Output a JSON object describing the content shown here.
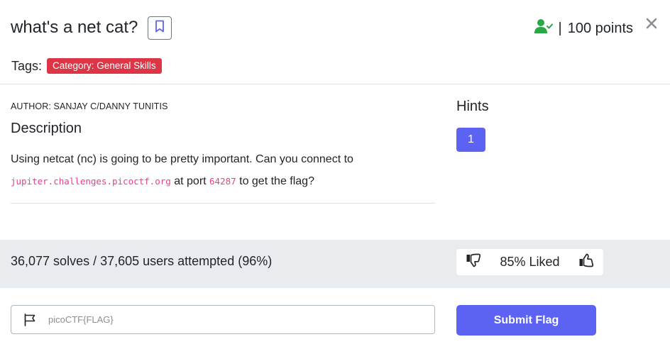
{
  "challenge": {
    "title": "what's a net cat?",
    "points_sep": "|",
    "points": "100 points"
  },
  "tags": {
    "label": "Tags:",
    "items": [
      "Category: General Skills"
    ]
  },
  "author": "AUTHOR: SANJAY C/DANNY TUNITIS",
  "description": {
    "heading": "Description",
    "text_1": "Using netcat (nc) is going to be pretty important. Can you connect to",
    "host": "jupiter.challenges.picoctf.org",
    "text_2": " at port ",
    "port": "64287",
    "text_3": " to get the flag?"
  },
  "hints": {
    "heading": "Hints",
    "items": [
      "1"
    ]
  },
  "stats": {
    "solves": "36,077 solves / 37,605 users attempted (96%)",
    "liked": "85% Liked"
  },
  "flag_form": {
    "placeholder": "picoCTF{FLAG}",
    "submit_label": "Submit Flag"
  },
  "colors": {
    "accent": "#5c63f2",
    "tag_red": "#dc3545",
    "solved_green": "#28a745",
    "code_pink": "#e83e8c"
  },
  "icons": [
    "bookmark-icon",
    "user-check-icon",
    "close-icon",
    "thumbs-down-icon",
    "thumbs-up-icon",
    "flag-icon"
  ]
}
